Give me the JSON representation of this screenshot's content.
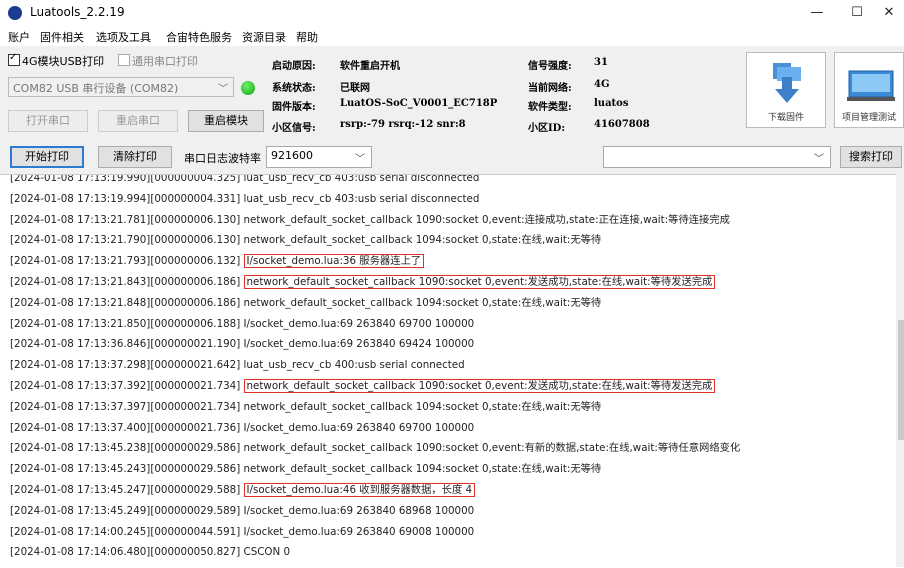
{
  "window": {
    "title": "Luatools_2.2.19",
    "minimize": "—",
    "maximize": "☐",
    "close": "✕"
  },
  "menu": [
    "账户",
    "固件相关",
    "选项及工具",
    "合宙特色服务",
    "资源目录",
    "帮助"
  ],
  "usb_print": {
    "label": "4G模块USB打印",
    "checked": true
  },
  "generic_serial": {
    "label": "通用串口打印",
    "checked": false
  },
  "port_select": {
    "value": "COM82 USB 串行设备 (COM82)"
  },
  "buttons": {
    "open_port": "打开串口",
    "restart_port": "重启串口",
    "restart_module": "重启模块",
    "start_print": "开始打印",
    "clear_print": "清除打印",
    "search_print": "搜索打印",
    "download_firmware": "下载固件",
    "project_test": "项目管理测试"
  },
  "baud": {
    "label": "串口日志波特率",
    "value": "921600"
  },
  "search": {
    "value": ""
  },
  "info": {
    "boot_reason_label": "启动原因:",
    "boot_reason": "软件重启开机",
    "sys_status_label": "系统状态:",
    "sys_status": "已联网",
    "firmware_label": "固件版本:",
    "firmware": "LuatOS-SoC_V0001_EC718P",
    "cell_signal_label": "小区信号:",
    "cell_signal": "rsrp:-79 rsrq:-12 snr:8",
    "signal_label": "信号强度:",
    "signal": "31",
    "network_label": "当前网络:",
    "network": "4G",
    "sw_type_label": "软件类型:",
    "sw_type": "luatos",
    "cell_id_label": "小区ID:",
    "cell_id": "41607808"
  },
  "log": [
    {
      "prefix": "[2024-01-08 17:13:19.990][000000004.325] ",
      "msg": "luat_usb_recv_cb 403:usb serial disconnected",
      "hl": false
    },
    {
      "prefix": "[2024-01-08 17:13:19.994][000000004.331] ",
      "msg": "luat_usb_recv_cb 403:usb serial disconnected",
      "hl": false
    },
    {
      "prefix": "[2024-01-08 17:13:21.781][000000006.130] ",
      "msg": "network_default_socket_callback 1090:socket 0,event:连接成功,state:正在连接,wait:等待连接完成",
      "hl": false
    },
    {
      "prefix": "[2024-01-08 17:13:21.790][000000006.130] ",
      "msg": "network_default_socket_callback 1094:socket 0,state:在线,wait:无等待",
      "hl": false
    },
    {
      "prefix": "[2024-01-08 17:13:21.793][000000006.132] ",
      "msg": "I/socket_demo.lua:36   服务器连上了",
      "hl": true
    },
    {
      "prefix": "[2024-01-08 17:13:21.843][000000006.186] ",
      "msg": "network_default_socket_callback 1090:socket 0,event:发送成功,state:在线,wait:等待发送完成",
      "hl": true
    },
    {
      "prefix": "[2024-01-08 17:13:21.848][000000006.186] ",
      "msg": "network_default_socket_callback 1094:socket 0,state:在线,wait:无等待",
      "hl": false
    },
    {
      "prefix": "[2024-01-08 17:13:21.850][000000006.188] ",
      "msg": "I/socket_demo.lua:69   263840 69700   100000",
      "hl": false
    },
    {
      "prefix": "[2024-01-08 17:13:36.846][000000021.190] ",
      "msg": "I/socket_demo.lua:69   263840 69424   100000",
      "hl": false
    },
    {
      "prefix": "[2024-01-08 17:13:37.298][000000021.642] ",
      "msg": "luat_usb_recv_cb 400:usb serial connected",
      "hl": false
    },
    {
      "prefix": "[2024-01-08 17:13:37.392][000000021.734] ",
      "msg": "network_default_socket_callback 1090:socket 0,event:发送成功,state:在线,wait:等待发送完成",
      "hl": true
    },
    {
      "prefix": "[2024-01-08 17:13:37.397][000000021.734] ",
      "msg": "network_default_socket_callback 1094:socket 0,state:在线,wait:无等待",
      "hl": false
    },
    {
      "prefix": "[2024-01-08 17:13:37.400][000000021.736] ",
      "msg": "I/socket_demo.lua:69   263840 69700   100000",
      "hl": false
    },
    {
      "prefix": "[2024-01-08 17:13:45.238][000000029.586] ",
      "msg": "network_default_socket_callback 1090:socket 0,event:有新的数据,state:在线,wait:等待任意网络变化",
      "hl": false
    },
    {
      "prefix": "[2024-01-08 17:13:45.243][000000029.586] ",
      "msg": "network_default_socket_callback 1094:socket 0,state:在线,wait:无等待",
      "hl": false
    },
    {
      "prefix": "[2024-01-08 17:13:45.247][000000029.588] ",
      "msg": "I/socket_demo.lua:46   收到服务器数据，长度      4",
      "hl": true
    },
    {
      "prefix": "[2024-01-08 17:13:45.249][000000029.589] ",
      "msg": "I/socket_demo.lua:69   263840 68968   100000",
      "hl": false
    },
    {
      "prefix": "[2024-01-08 17:14:00.245][000000044.591] ",
      "msg": "I/socket_demo.lua:69   263840 69008   100000",
      "hl": false
    },
    {
      "prefix": "[2024-01-08 17:14:06.480][000000050.827] ",
      "msg": "CSCON 0",
      "hl": false
    }
  ]
}
